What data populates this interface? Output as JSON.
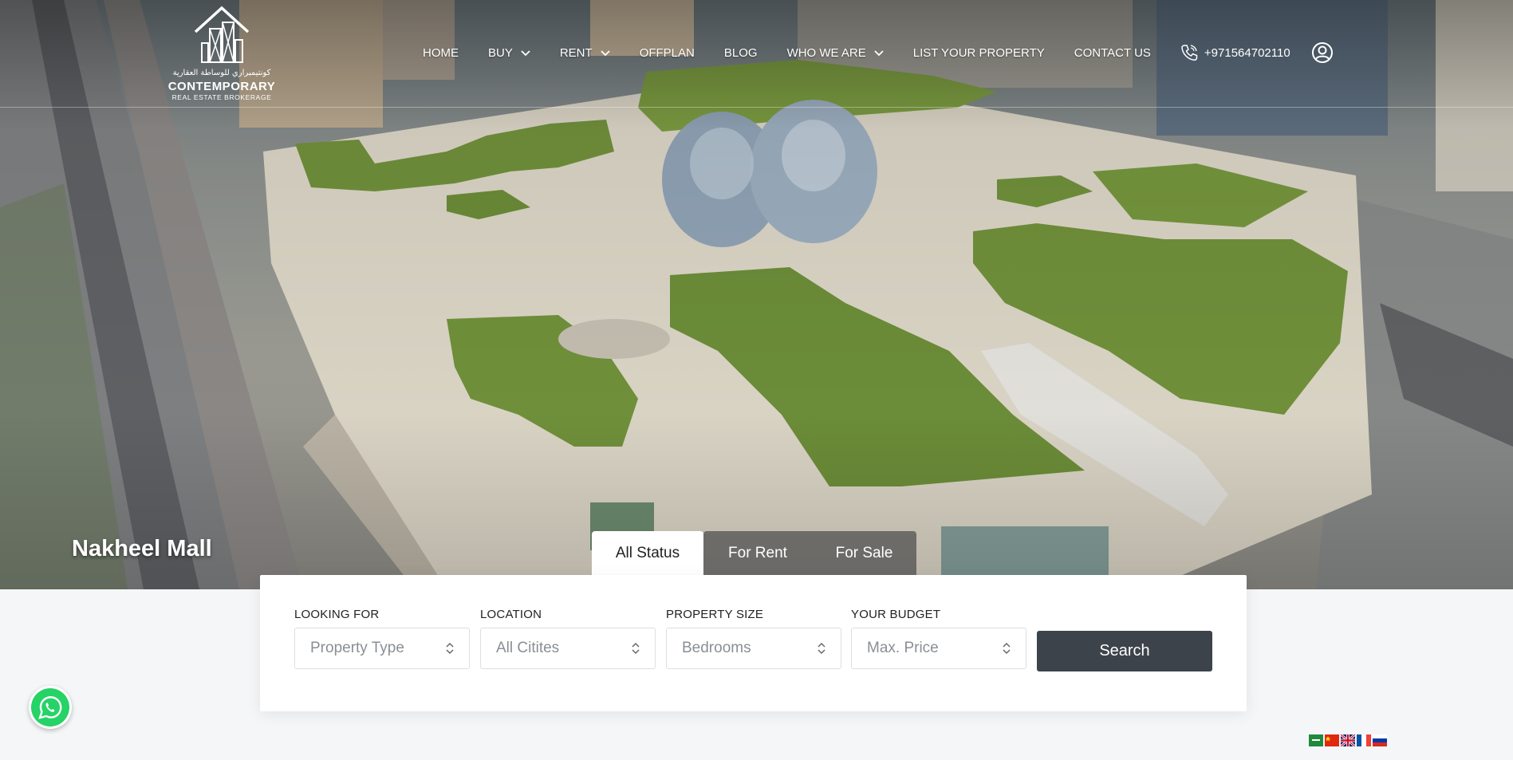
{
  "logo": {
    "arabic_text": "كونتيمبراري للوساطة العقارية",
    "brand": "CONTEMPORARY",
    "subtitle": "REAL ESTATE BROKERAGE"
  },
  "nav": {
    "items": [
      {
        "label": "HOME",
        "has_dropdown": false
      },
      {
        "label": "BUY",
        "has_dropdown": true
      },
      {
        "label": "RENT",
        "has_dropdown": true
      },
      {
        "label": "OFFPLAN",
        "has_dropdown": false
      },
      {
        "label": "BLOG",
        "has_dropdown": false
      },
      {
        "label": "WHO WE ARE",
        "has_dropdown": true
      },
      {
        "label": "LIST YOUR PROPERTY",
        "has_dropdown": false
      },
      {
        "label": "CONTACT US",
        "has_dropdown": false
      }
    ],
    "phone": "+971564702110",
    "user_icon": "user-circle-icon"
  },
  "hero": {
    "caption": "Nakheel Mall"
  },
  "tabs": [
    {
      "label": "All Status",
      "active": true
    },
    {
      "label": "For Rent",
      "active": false
    },
    {
      "label": "For Sale",
      "active": false
    }
  ],
  "search": {
    "fields": [
      {
        "label": "LOOKING FOR",
        "value": "Property Type"
      },
      {
        "label": "LOCATION",
        "value": "All Citites"
      },
      {
        "label": "PROPERTY SIZE",
        "value": "Bedrooms"
      },
      {
        "label": "YOUR BUDGET",
        "value": "Max. Price"
      }
    ],
    "button": "Search"
  },
  "colors": {
    "search_button": "#3d434a",
    "whatsapp": "#25d366",
    "tab_inactive": "#505050"
  },
  "languages": [
    "ar",
    "zh",
    "en",
    "fr",
    "ru"
  ]
}
